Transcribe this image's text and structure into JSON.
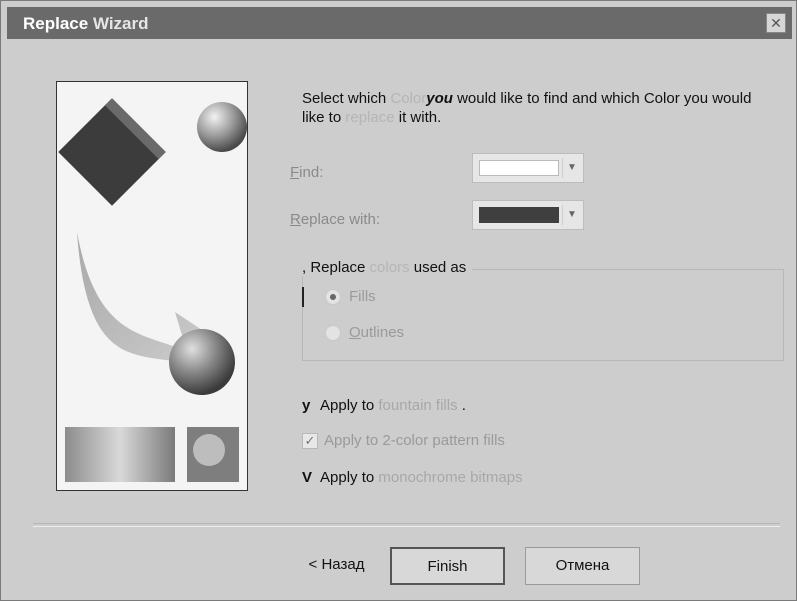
{
  "window": {
    "title_main": "Replace ",
    "title_faded": "Wizard",
    "close_glyph": "✕"
  },
  "instruction": {
    "part1": "Select which ",
    "color_word": "Color",
    "you_word": "you",
    "part2": " would like to find and which Color you would like to ",
    "replace_word": "replace",
    "part3": " it with."
  },
  "find": {
    "label_hot": "F",
    "label_rest": "ind:",
    "swatch_color": "#ffffff"
  },
  "replace_with": {
    "label_hot": "R",
    "label_rest": "eplace with:",
    "swatch_color": "#3f3f3f"
  },
  "group": {
    "prefix": ", ",
    "title_a": "Replace ",
    "title_light": "colors",
    "title_b": " used as",
    "fills_label": "Fills",
    "outlines_hot": "O",
    "outlines_rest": "utlines"
  },
  "options": {
    "fountain_mark": "y",
    "fountain_a": "Apply to ",
    "fountain_light": "fountain fills",
    "fountain_tail": " .",
    "pattern_label": "Apply to 2-color pattern fills",
    "mono_mark": "V",
    "mono_a": "Apply to ",
    "mono_light": "monochrome bitmaps"
  },
  "buttons": {
    "back": "< Назад",
    "finish": "Finish",
    "cancel": "Отмена"
  }
}
